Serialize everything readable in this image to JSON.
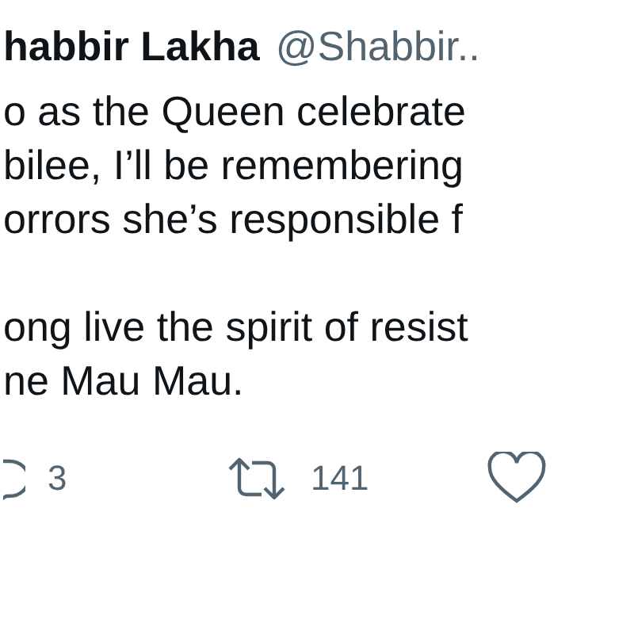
{
  "tweet": {
    "author_name": "habbir Lakha",
    "handle": "@Shabbir..",
    "paragraphs": [
      [
        "o as the Queen celebrate",
        "bilee, I’ll be remembering",
        "orrors she’s responsible f"
      ],
      [
        "ong live the spirit of resist",
        "ne Mau Mau."
      ]
    ],
    "actions": [
      {
        "kind": "reply",
        "count": "3"
      },
      {
        "kind": "retweet",
        "count": "141"
      },
      {
        "kind": "like"
      }
    ]
  }
}
